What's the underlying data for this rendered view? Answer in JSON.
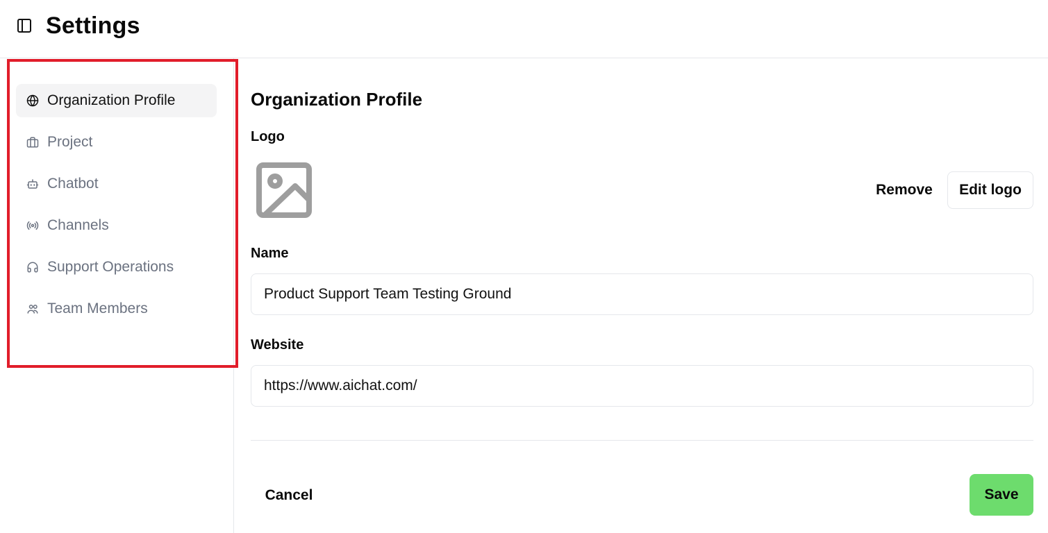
{
  "header": {
    "title": "Settings",
    "toggle_icon": "sidebar-toggle-icon"
  },
  "sidebar": {
    "items": [
      {
        "label": "Organization Profile",
        "icon": "globe-icon",
        "active": true
      },
      {
        "label": "Project",
        "icon": "briefcase-icon",
        "active": false
      },
      {
        "label": "Chatbot",
        "icon": "bot-icon",
        "active": false
      },
      {
        "label": "Channels",
        "icon": "radio-icon",
        "active": false
      },
      {
        "label": "Support Operations",
        "icon": "headset-icon",
        "active": false
      },
      {
        "label": "Team Members",
        "icon": "users-icon",
        "active": false
      }
    ],
    "highlight_color": "#e11d2a"
  },
  "main": {
    "section_title": "Organization Profile",
    "logo": {
      "label": "Logo",
      "placeholder_icon": "image-placeholder-icon",
      "remove_label": "Remove",
      "edit_label": "Edit logo"
    },
    "name": {
      "label": "Name",
      "value": "Product Support Team Testing Ground"
    },
    "website": {
      "label": "Website",
      "value": "https://www.aichat.com/"
    },
    "actions": {
      "cancel_label": "Cancel",
      "save_label": "Save",
      "save_color": "#6ddc6d"
    }
  }
}
